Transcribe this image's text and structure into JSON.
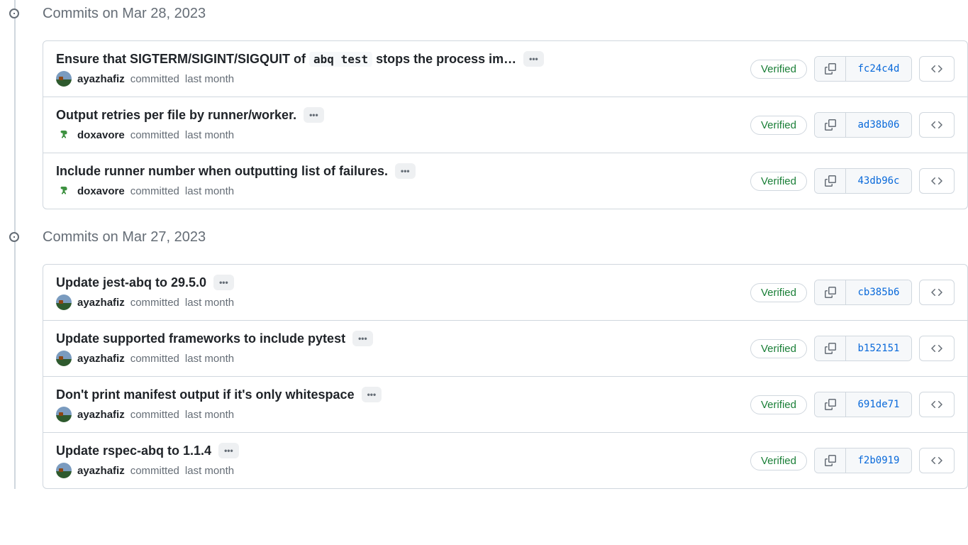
{
  "verified_label": "Verified",
  "meta_committed": "committed",
  "groups": [
    {
      "date": "Commits on Mar 28, 2023",
      "commits": [
        {
          "title_pre": "Ensure that SIGTERM/SIGINT/SIGQUIT of ",
          "title_code": "abq test",
          "title_post": " stops the process im…",
          "author": "ayazhafiz",
          "avatar": "field",
          "time": "last month",
          "sha": "fc24c4d"
        },
        {
          "title_pre": "Output retries per file by runner/worker.",
          "title_code": "",
          "title_post": "",
          "author": "doxavore",
          "avatar": "dino",
          "time": "last month",
          "sha": "ad38b06"
        },
        {
          "title_pre": "Include runner number when outputting list of failures.",
          "title_code": "",
          "title_post": "",
          "author": "doxavore",
          "avatar": "dino",
          "time": "last month",
          "sha": "43db96c"
        }
      ]
    },
    {
      "date": "Commits on Mar 27, 2023",
      "commits": [
        {
          "title_pre": "Update jest-abq to 29.5.0",
          "title_code": "",
          "title_post": "",
          "author": "ayazhafiz",
          "avatar": "field",
          "time": "last month",
          "sha": "cb385b6"
        },
        {
          "title_pre": "Update supported frameworks to include pytest",
          "title_code": "",
          "title_post": "",
          "author": "ayazhafiz",
          "avatar": "field",
          "time": "last month",
          "sha": "b152151"
        },
        {
          "title_pre": "Don't print manifest output if it's only whitespace",
          "title_code": "",
          "title_post": "",
          "author": "ayazhafiz",
          "avatar": "field",
          "time": "last month",
          "sha": "691de71"
        },
        {
          "title_pre": "Update rspec-abq to 1.1.4",
          "title_code": "",
          "title_post": "",
          "author": "ayazhafiz",
          "avatar": "field",
          "time": "last month",
          "sha": "f2b0919"
        }
      ]
    }
  ]
}
